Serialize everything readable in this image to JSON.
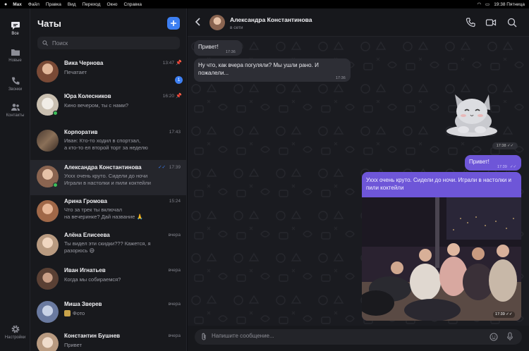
{
  "menubar": {
    "app": "Max",
    "items": [
      "Файл",
      "Правка",
      "Вид",
      "Переход",
      "Окно",
      "Справка"
    ],
    "clock": "19:38 Пятница"
  },
  "rail": {
    "items": [
      {
        "label": "Все",
        "icon": "chat-bubble-icon"
      },
      {
        "label": "Новые",
        "icon": "folder-icon"
      },
      {
        "label": "Звонки",
        "icon": "phone-icon"
      },
      {
        "label": "Контакты",
        "icon": "contacts-icon"
      }
    ],
    "settings": "Настройки"
  },
  "list": {
    "title": "Чаты",
    "search_placeholder": "Поиск",
    "chats": [
      {
        "name": "Вика Чернова",
        "time": "13:47",
        "preview": "Печатает",
        "preview2": "",
        "badge": "1",
        "pinned": true,
        "online": false,
        "color": "#8a5a44"
      },
      {
        "name": "Юра Колесников",
        "time": "16:20",
        "preview": "Кино вечером, ты с нами?",
        "preview2": "",
        "badge": "",
        "pinned": true,
        "online": true,
        "color": "#d9d0c4"
      },
      {
        "name": "Корпоратив",
        "time": "17:43",
        "preview": "Иван: Кто-то ходил в спортзал,",
        "preview2": "а кто-то ел второй торт за неделю",
        "badge": "",
        "pinned": false,
        "online": false,
        "color": "#6b5a48"
      },
      {
        "name": "Александра Константинова",
        "time": "17:39",
        "preview": "Уххх очень круто. Сидели до ночи",
        "preview2": "Играли в настолки и пили коктейли",
        "badge": "",
        "pinned": false,
        "online": true,
        "color": "#b08a70"
      },
      {
        "name": "Арина Громова",
        "time": "15:24",
        "preview": "Что за трек ты включал",
        "preview2": "на вечеринке? Дай название 🙏",
        "badge": "",
        "pinned": false,
        "online": false,
        "color": "#c28a6a"
      },
      {
        "name": "Алёна Елисеева",
        "time": "вчера",
        "preview": "Ты видел эти скидки??? Кажется, я",
        "preview2": "разорюсь 😅",
        "badge": "",
        "pinned": false,
        "online": false,
        "color": "#d6b8a0"
      },
      {
        "name": "Иван Игнатьев",
        "time": "вчера",
        "preview": "Когда мы собираемся?",
        "preview2": "",
        "badge": "",
        "pinned": false,
        "online": false,
        "color": "#7a5a4a"
      },
      {
        "name": "Миша Зверев",
        "time": "вчера",
        "preview": "Фото",
        "preview2": "",
        "badge": "",
        "pinned": false,
        "online": false,
        "color": "#9aa6c0"
      },
      {
        "name": "Константин Бушнев",
        "time": "вчера",
        "preview": "Привет",
        "preview2": "",
        "badge": "",
        "pinned": false,
        "online": false,
        "color": "#c8a890"
      }
    ]
  },
  "chat": {
    "name": "Александра Константинова",
    "status": "в сети",
    "composer_placeholder": "Напишите сообщение...",
    "messages": {
      "m1": {
        "text": "Привет!",
        "time": "17:36"
      },
      "m2": {
        "text": "Ну что, как вчера погуляли? Мы ушли рано. И пожалели...",
        "time": "17:36"
      },
      "sticker_time": "17:38",
      "m3": {
        "text": "Привет!",
        "time": "17:39"
      },
      "m4": {
        "text": "Уххх очень круто. Сидели до ночи. Играли в настолки и пили коктейли",
        "time": "17:39"
      }
    }
  },
  "colors": {
    "accent": "#3d7ff2",
    "outgoing": "#6e56d8",
    "online": "#3dbf5a"
  }
}
